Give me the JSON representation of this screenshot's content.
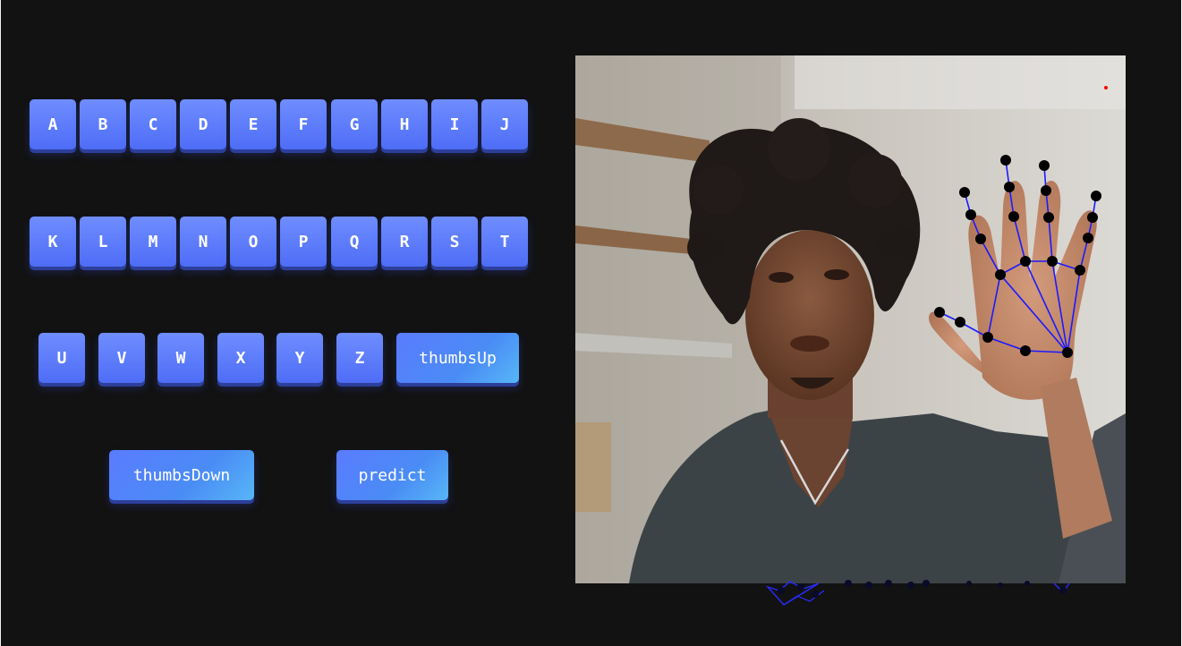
{
  "keys": {
    "row1": [
      "A",
      "B",
      "C",
      "D",
      "E",
      "F",
      "G",
      "H",
      "I",
      "J"
    ],
    "row2": [
      "K",
      "L",
      "M",
      "N",
      "O",
      "P",
      "Q",
      "R",
      "S",
      "T"
    ],
    "row3": [
      "U",
      "V",
      "W",
      "X",
      "Y",
      "Z"
    ],
    "thumbs_up": "thumbsUp",
    "thumbs_down": "thumbsDown",
    "predict": "predict"
  },
  "colors": {
    "background": "#121212",
    "button": "#5a78fb",
    "landmark_point": "#000000",
    "landmark_line": "#1a1aff",
    "indicator_dot": "#ff0000"
  },
  "webcam": {
    "hand_landmarks_detected": true,
    "landmark_count": 21
  }
}
